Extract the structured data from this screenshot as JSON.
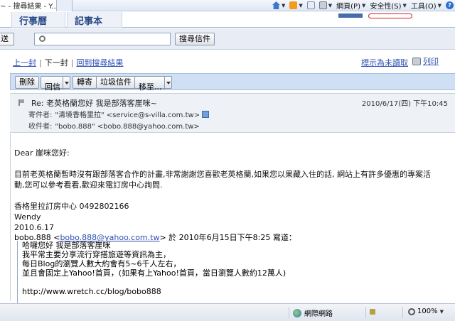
{
  "browser": {
    "tab_title": "~ - 搜尋結果 - Y...",
    "commands": {
      "page": "網頁(P)",
      "safety": "安全性(S)",
      "tools": "工具(O)"
    }
  },
  "app_tabs": [
    "行事曆",
    "記事本"
  ],
  "search": {
    "send_stub": "送",
    "placeholder": "",
    "button": "搜尋信件"
  },
  "nav": {
    "prev": "上一封",
    "next": "下一封",
    "back": "回到搜尋結果",
    "mark_unread": "標示為未讀取",
    "print": "列印"
  },
  "actions": {
    "delete": "刪除",
    "reply": "回信",
    "forward": "轉寄",
    "spam": "垃圾信件",
    "move": "移至..."
  },
  "message": {
    "subject": "Re: 老英格蘭您好 我是部落客崖咪~",
    "date": "2010/6/17(四) 下午10:45",
    "from_label": "寄件者:",
    "from": "\"清境香格里拉\" <service@s-villa.com.tw>",
    "to_label": "收件者:",
    "to": "\"bobo.888\" <bobo.888@yahoo.com.tw>",
    "body": {
      "greeting": "Dear 崖咪您好:",
      "para1_line1": "目前老英格蘭暫時沒有跟部落客合作的計畫,非常謝謝您喜歡老英格蘭,如果您以果藏入住的話, 網站上有許多優惠的專案活",
      "para1_line2": "動,您可以參考看看,歡迎來電訂房中心詢問.",
      "sign1": "香格里拉訂房中心 0492802166",
      "sign2": "Wendy",
      "sign3": "2010.6.17"
    },
    "quote_head": {
      "name": "bobo.888 <",
      "email": "bobo.888@yahoo.com.tw",
      "rest": "> 於 2010年6月15日下午8:25 寫道："
    },
    "quote_lines": [
      "哈囉您好 我是部落客崖咪",
      "我平常主要分享流行穿搭旅遊等資訊為主，",
      "每日Blog的瀏覽人數大約會有5~6千人左右，",
      "並且會固定上Yahoo!首頁，(如果有上Yahoo!首頁，當日瀏覽人數約12萬人)",
      "",
      "http://www.wretch.cc/blog/bobo888"
    ]
  },
  "status": {
    "zone": "網際網路",
    "zoom": "100%"
  }
}
